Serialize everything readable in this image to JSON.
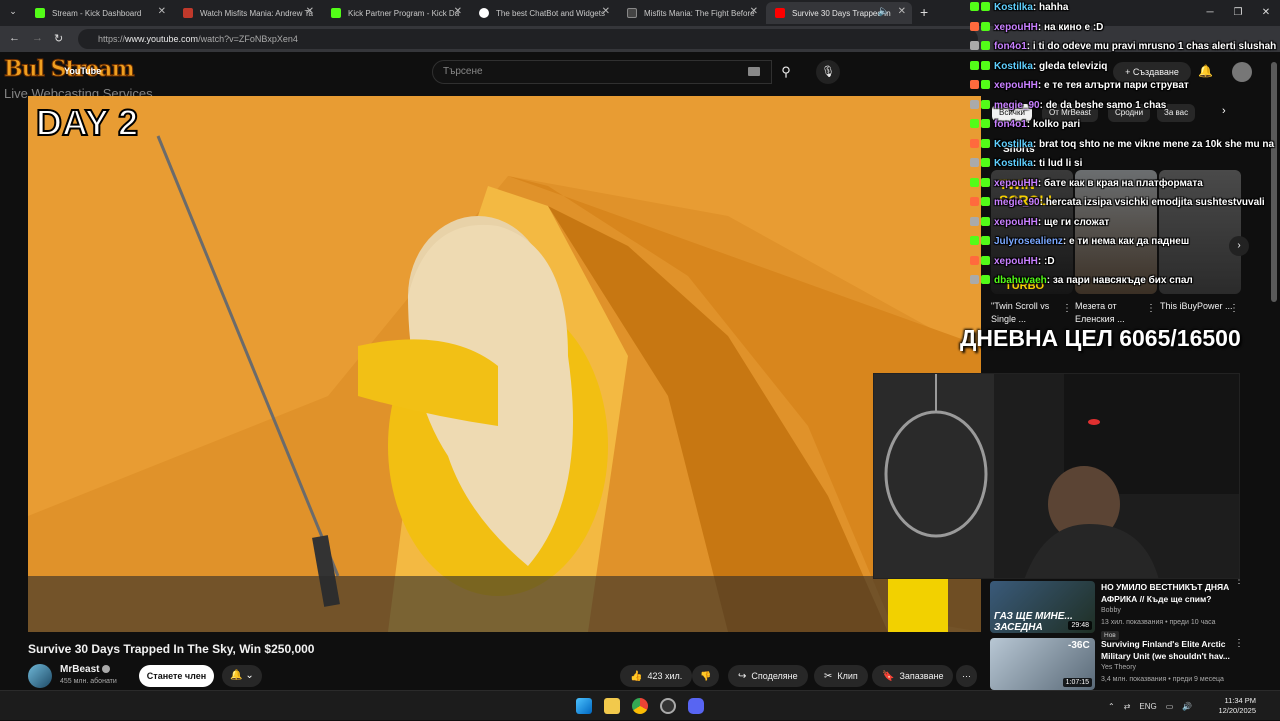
{
  "browser": {
    "tabs": [
      {
        "title": "Stream - Kick Dashboard",
        "color": "#53fc18"
      },
      {
        "title": "Watch Misfits Mania: Andrew Ta",
        "color": "#c0392b"
      },
      {
        "title": "Kick Partner Program - Kick Da",
        "color": "#53fc18"
      },
      {
        "title": "The best ChatBot and Widgets",
        "color": "#ffffff"
      },
      {
        "title": "Misfits Mania: The Fight Before",
        "color": "#444444"
      },
      {
        "title": "Survive 30 Days Trapped In",
        "color": "#ff0000"
      }
    ],
    "url_prefix": "https://",
    "url_domain": "www.youtube.com",
    "url_rest": "/watch?v=ZFoNBxpXen4"
  },
  "logo": {
    "main": "Bul Stream",
    "youtube": "YouTube",
    "sub": "Live Webcasting Services"
  },
  "search": {
    "placeholder": "Търсене"
  },
  "header": {
    "create": "Създаване"
  },
  "video": {
    "overlay_text": "DAY 2",
    "title": "Survive 30 Days Trapped In The Sky, Win $250,000",
    "channel": "MrBeast",
    "subscribers": "455 млн. абонати",
    "join": "Станете член",
    "likes": "423 хил.",
    "share": "Споделяне",
    "clip": "Клип",
    "save": "Запазване"
  },
  "chips": [
    "Всички",
    "От MrBeast",
    "Сродни",
    "За вас"
  ],
  "shorts": {
    "heading": "Shorts",
    "items": [
      {
        "title": "\"Twin Scroll vs Single ...",
        "overlay": "TWIN SCROLL",
        "overlay2": "TURBO"
      },
      {
        "title": "Мезета от Еленския ...",
        "overlay": "",
        "overlay2": ""
      },
      {
        "title": "This iBuyPower ...",
        "overlay": "",
        "overlay2": ""
      }
    ]
  },
  "recommended": [
    {
      "title": "НО УМИЛО ВЕСТНИКЪТ ДНЯА АФРИКА // Къде ще спим?",
      "channel": "Bobby",
      "meta": "13 хил. показвания • преди 10 часа",
      "badge": "Нов",
      "duration": "29:48",
      "overlay": "ГАЗ ЩЕ МИНЕ... ЗАСЕДНА"
    },
    {
      "title": "Surviving Finland's Elite Arctic Military Unit (we shouldn't hav...",
      "channel": "Yes Theory",
      "meta": "3,4 млн. показвания • преди 9 месеца",
      "badge": "",
      "duration": "1:07:15",
      "overlay": "-36C"
    }
  ],
  "chat": [
    {
      "user": "Kostilka",
      "text": ": hahha",
      "color": "#5fd0ff"
    },
    {
      "user": "xepouHH",
      "text": ": на кино е :D",
      "color": "#c880ff"
    },
    {
      "user": "fon4o1",
      "text": ": i ti do odeve mu pravi mrusno 1 chas alerti slushah",
      "color": "#c880ff"
    },
    {
      "user": "Kostilka",
      "text": ": gleda televiziq",
      "color": "#5fd0ff"
    },
    {
      "user": "xepouHH",
      "text": ": е те тея алърти пари струват",
      "color": "#c880ff"
    },
    {
      "user": "megie_90",
      "text": ": de da beshe samo 1 chas",
      "color": "#c880ff"
    },
    {
      "user": "fon4o1",
      "text": ": kolko pari",
      "color": "#c880ff"
    },
    {
      "user": "Kostilka",
      "text": ": brat toq shto ne me vikne mene za 10k she mu na",
      "color": "#5fd0ff"
    },
    {
      "user": "Kostilka",
      "text": ": ti lud li si",
      "color": "#5fd0ff"
    },
    {
      "user": "xepouHH",
      "text": ": бате как в края на платформата",
      "color": "#c880ff"
    },
    {
      "user": "megie_90",
      "text": ": hercata izsipa vsichki emodjita sushtestvuvali",
      "color": "#c880ff"
    },
    {
      "user": "xepouHH",
      "text": ": ще ги сложат",
      "color": "#c880ff"
    },
    {
      "user": "Julyrosealienz",
      "text": ": е ти нема как да паднеш",
      "color": "#7aa8ff"
    },
    {
      "user": "xepouHH",
      "text": ": :D",
      "color": "#c880ff"
    },
    {
      "user": "dbahuvaeh",
      "text": ": за пари навсякъде бих спал",
      "color": "#53fc18"
    }
  ],
  "goal": {
    "text": "ДНЕВНА ЦЕЛ 6065/16500"
  },
  "taskbar": {
    "lang": "ENG",
    "time": "11:34 PM",
    "date": "12/20/2025"
  }
}
